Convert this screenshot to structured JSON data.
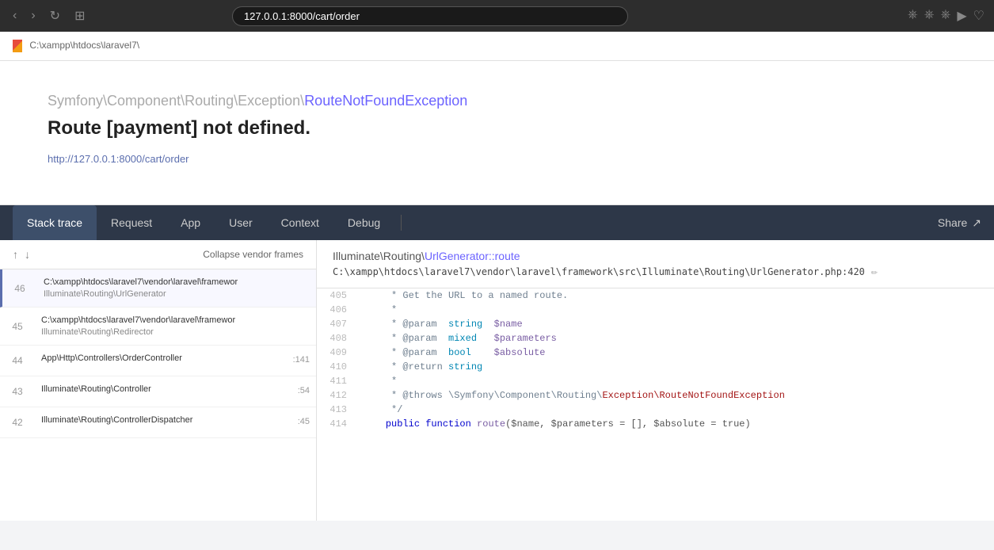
{
  "browser": {
    "url": "127.0.0.1:8000/cart/order",
    "nav_back": "‹",
    "nav_forward": "›",
    "reload": "↺",
    "grid": "⊞"
  },
  "breadcrumb": {
    "path": "C:\\xampp\\htdocs\\laravel7\\"
  },
  "exception": {
    "class_prefix": "Symfony\\Component\\Routing\\Exception\\",
    "class_name": "RouteNotFoundException",
    "message": "Route [payment] not defined.",
    "url": "http://127.0.0.1:8000/cart/order"
  },
  "tabs": {
    "items": [
      {
        "label": "Stack trace",
        "active": true
      },
      {
        "label": "Request",
        "active": false
      },
      {
        "label": "App",
        "active": false
      },
      {
        "label": "User",
        "active": false
      },
      {
        "label": "Context",
        "active": false
      },
      {
        "label": "Debug",
        "active": false
      }
    ],
    "share_label": "Share"
  },
  "frame_list": {
    "collapse_label": "Collapse vendor frames",
    "sort_up": "↑",
    "sort_down": "↓",
    "frames": [
      {
        "number": "46",
        "path": "C:\\xampp\\htdocs\\laravel7\\vendor\\laravel\\framewor",
        "class": "Illuminate\\Routing\\UrlGenerator",
        "line": "",
        "active": true
      },
      {
        "number": "45",
        "path": "C:\\xampp\\htdocs\\laravel7\\vendor\\laravel\\framewor",
        "class": "Illuminate\\Routing\\Redirector",
        "line": "",
        "active": false
      },
      {
        "number": "44",
        "path": "App\\Http\\Controllers\\OrderController",
        "class": "",
        "line": ":141",
        "active": false
      },
      {
        "number": "43",
        "path": "Illuminate\\Routing\\Controller",
        "class": "",
        "line": ":54",
        "active": false
      },
      {
        "number": "42",
        "path": "Illuminate\\Routing\\ControllerDispatcher",
        "class": "",
        "line": ":45",
        "active": false
      }
    ]
  },
  "code_view": {
    "class_name": "Illuminate\\Routing\\",
    "method_name": "UrlGenerator::route",
    "file_path": "C:\\xampp\\htdocs\\laravel7\\vendor\\laravel\\framework\\src\\Illuminate\\Routing\\UrlGenerator.php:420",
    "lines": [
      {
        "num": "405",
        "content": "     * Get the URL to a named route.",
        "type": "comment"
      },
      {
        "num": "406",
        "content": "     *",
        "type": "comment"
      },
      {
        "num": "407",
        "content": "     * @param  string  $name",
        "type": "comment"
      },
      {
        "num": "408",
        "content": "     * @param  mixed   $parameters",
        "type": "comment"
      },
      {
        "num": "409",
        "content": "     * @param  bool    $absolute",
        "type": "comment"
      },
      {
        "num": "410",
        "content": "     * @return string",
        "type": "comment"
      },
      {
        "num": "411",
        "content": "     *",
        "type": "comment"
      },
      {
        "num": "412",
        "content": "     * @throws \\Symfony\\Component\\Routing\\Exception\\RouteNotFoundException",
        "type": "comment-throws"
      },
      {
        "num": "413",
        "content": "     */",
        "type": "comment"
      },
      {
        "num": "414",
        "content": "    public function route($name, $parameters = [], $absolute = true)",
        "type": "code"
      }
    ]
  }
}
